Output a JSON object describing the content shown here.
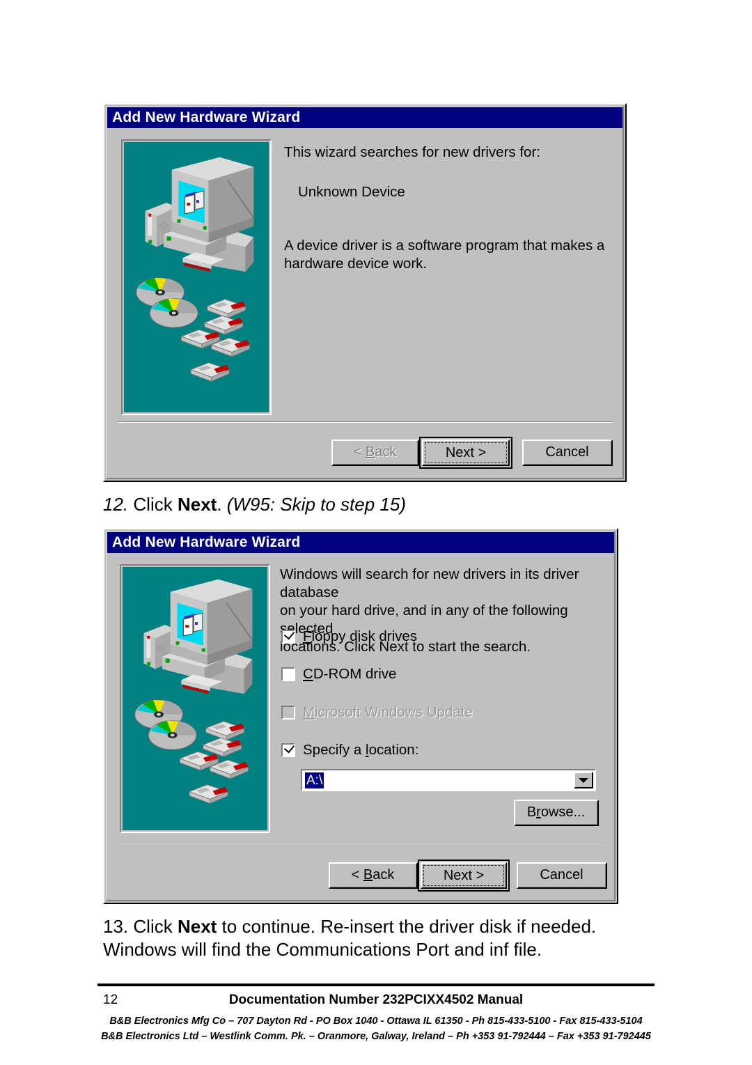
{
  "page": {
    "number": "12",
    "doc_line": "Documentation Number 232PCIXX4502 Manual",
    "address_line1": "B&B Electronics Mfg Co – 707 Dayton Rd - PO Box 1040 - Ottawa IL 61350 - Ph 815-433-5100 - Fax 815-433-5104",
    "address_line2": "B&B Electronics Ltd – Westlink Comm. Pk. – Oranmore, Galway, Ireland – Ph +353 91-792444 – Fax +353 91-792445"
  },
  "steps": {
    "step12": {
      "number": "12.",
      "text_before": "Click ",
      "bold": "Next",
      "text_after": ".  ",
      "italic": "(W95: Skip to step 15)"
    },
    "step13": {
      "number": "13.",
      "text_before": "Click ",
      "bold": "Next",
      "text_after": " to continue.  Re-insert the driver disk if needed.",
      "line2": "Windows will find the Communications Port and inf file."
    }
  },
  "dialog1": {
    "title": "Add New Hardware Wizard",
    "heading": "This wizard searches for new drivers for:",
    "device": "Unknown Device",
    "description": "A device driver is a software program that makes a\nhardware device work.",
    "buttons": {
      "back": "< Back",
      "back_accel": "B",
      "next": "Next >",
      "cancel": "Cancel"
    },
    "illustration": "computer-media-illustration"
  },
  "dialog2": {
    "title": "Add New Hardware Wizard",
    "description": "Windows will search for new drivers in its driver database\non your hard drive, and in any of the following selected\nlocations. Click Next to start the search.",
    "checkboxes": [
      {
        "label": "Floppy disk drives",
        "accel": "F",
        "checked": true,
        "enabled": true
      },
      {
        "label": "CD-ROM drive",
        "accel": "C",
        "checked": false,
        "enabled": true
      },
      {
        "label": "Microsoft Windows Update",
        "accel": "M",
        "checked": false,
        "enabled": false
      },
      {
        "label": "Specify a location:",
        "accel": "l",
        "checked": true,
        "enabled": true
      }
    ],
    "location_value": "A:\\",
    "browse_label": "Browse...",
    "browse_accel": "r",
    "buttons": {
      "back": "< Back",
      "back_accel": "B",
      "next": "Next >",
      "cancel": "Cancel"
    },
    "illustration": "computer-media-illustration"
  },
  "colors": {
    "titlebar": "#000080",
    "dialog_face": "#c0c0c0",
    "illustration_bg": "#008080",
    "selection": "#000080",
    "disabled_text": "#808080"
  }
}
